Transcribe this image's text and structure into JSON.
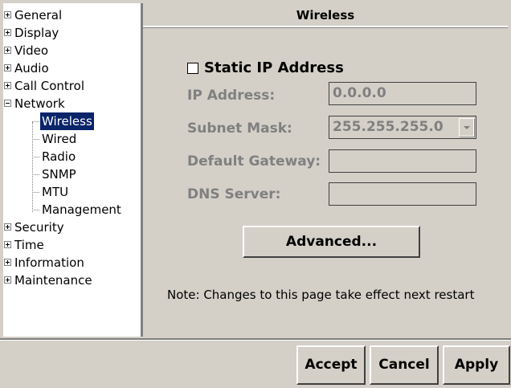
{
  "tree": {
    "items": [
      {
        "label": "General",
        "expanded": false
      },
      {
        "label": "Display",
        "expanded": false
      },
      {
        "label": "Video",
        "expanded": false
      },
      {
        "label": "Audio",
        "expanded": false
      },
      {
        "label": "Call Control",
        "expanded": false
      },
      {
        "label": "Network",
        "expanded": true
      }
    ],
    "network_children": [
      "Wireless",
      "Wired",
      "Radio",
      "SNMP",
      "MTU",
      "Management"
    ],
    "selected": "Wireless",
    "more_items": [
      {
        "label": "Security",
        "expanded": false
      },
      {
        "label": "Time",
        "expanded": false
      },
      {
        "label": "Information",
        "expanded": false
      },
      {
        "label": "Maintenance",
        "expanded": false
      }
    ]
  },
  "panel": {
    "title": "Wireless",
    "static_ip_label": "Static IP Address",
    "static_ip_checked": false,
    "ip_label": "IP Address:",
    "ip_value": "0.0.0.0",
    "subnet_label": "Subnet Mask:",
    "subnet_value": "255.255.255.0",
    "gateway_label": "Default Gateway:",
    "gateway_value": "",
    "dns_label": "DNS Server:",
    "dns_value": "",
    "advanced_label": "Advanced...",
    "note": "Note: Changes to this page take effect next restart"
  },
  "footer": {
    "accept_label": "Accept",
    "cancel_label": "Cancel",
    "apply_label": "Apply"
  }
}
